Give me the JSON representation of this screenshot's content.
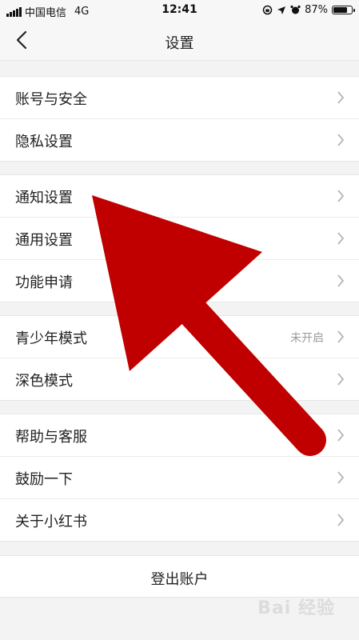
{
  "status_bar": {
    "carrier": "中国电信",
    "network": "4G",
    "time": "12:41",
    "battery": "87%",
    "battery_level": 0.87,
    "icons": [
      "signal-icon",
      "screen-lock-icon",
      "location-icon",
      "alarm-icon",
      "battery-icon"
    ]
  },
  "header": {
    "title": "设置",
    "back_icon": "chevron-left-icon"
  },
  "groups": [
    {
      "items": [
        {
          "label": "账号与安全"
        },
        {
          "label": "隐私设置"
        }
      ]
    },
    {
      "items": [
        {
          "label": "通知设置"
        },
        {
          "label": "通用设置"
        },
        {
          "label": "功能申请"
        }
      ]
    },
    {
      "items": [
        {
          "label": "青少年模式",
          "value": "未开启"
        },
        {
          "label": "深色模式"
        }
      ]
    },
    {
      "items": [
        {
          "label": "帮助与客服"
        },
        {
          "label": "鼓励一下"
        },
        {
          "label": "关于小红书"
        }
      ]
    }
  ],
  "logout_label": "登出账户",
  "annotation": {
    "type": "arrow",
    "color": "#c00000"
  },
  "watermark": "Bai 经验",
  "colors": {
    "background": "#f3f3f3",
    "card": "#ffffff",
    "arrow": "#c00000",
    "muted_text": "#9a9a9a"
  }
}
